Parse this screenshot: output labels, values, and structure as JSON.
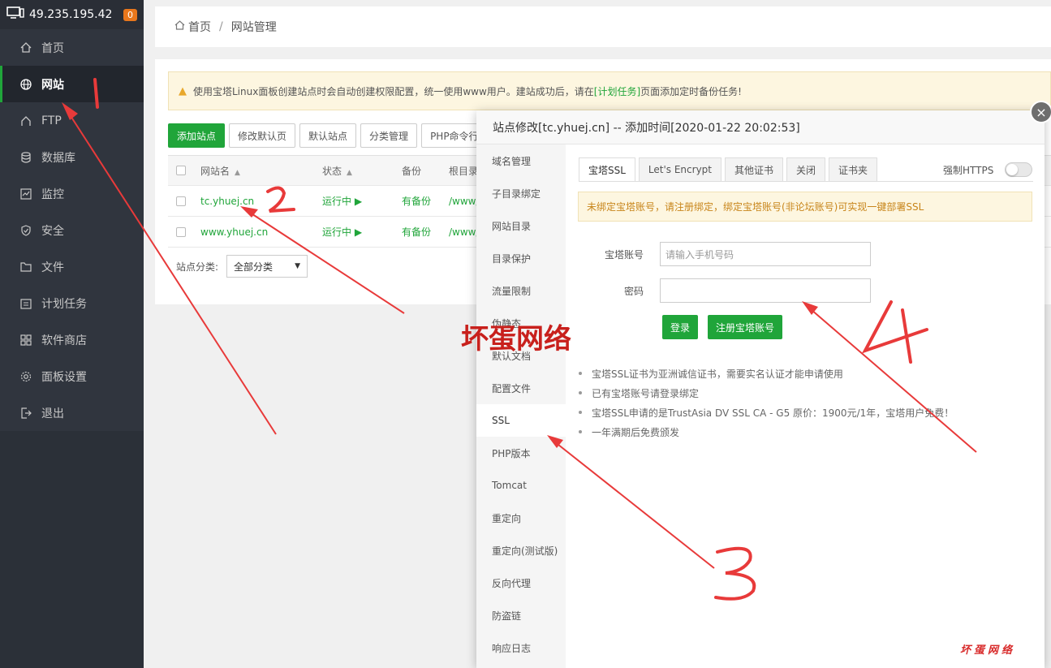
{
  "sidebar": {
    "ip": "49.235.195.42",
    "badge": "0",
    "items": [
      {
        "label": "首页",
        "icon": "home-icon"
      },
      {
        "label": "网站",
        "icon": "globe-icon"
      },
      {
        "label": "FTP",
        "icon": "ftp-icon"
      },
      {
        "label": "数据库",
        "icon": "database-icon"
      },
      {
        "label": "监控",
        "icon": "monitor-icon"
      },
      {
        "label": "安全",
        "icon": "shield-icon"
      },
      {
        "label": "文件",
        "icon": "folder-icon"
      },
      {
        "label": "计划任务",
        "icon": "calendar-icon"
      },
      {
        "label": "软件商店",
        "icon": "grid-icon"
      },
      {
        "label": "面板设置",
        "icon": "gear-icon"
      },
      {
        "label": "退出",
        "icon": "exit-icon"
      }
    ],
    "plus": "+"
  },
  "breadcrumb": {
    "home": "首页",
    "sep": "/",
    "current": "网站管理"
  },
  "warning": {
    "prefix": "使用宝塔Linux面板创建站点时会自动创建权限配置，统一使用www用户。建站成功后，请在",
    "link": "[计划任务]",
    "suffix": "页面添加定时备份任务!"
  },
  "toolbar": [
    "添加站点",
    "修改默认页",
    "默认站点",
    "分类管理",
    "PHP命令行"
  ],
  "table": {
    "headers": {
      "name": "网站名",
      "status": "状态",
      "backup": "备份",
      "root": "根目录"
    },
    "rows": [
      {
        "name": "tc.yhuej.cn",
        "status": "运行中 ▶",
        "backup": "有备份",
        "root": "/www/"
      },
      {
        "name": "www.yhuej.cn",
        "status": "运行中 ▶",
        "backup": "有备份",
        "root": "/www/"
      }
    ]
  },
  "category": {
    "label": "站点分类:",
    "value": "全部分类",
    "arrow": "▼"
  },
  "modal": {
    "title": "站点修改[tc.yhuej.cn] -- 添加时间[2020-01-22 20:02:53]",
    "close": "×",
    "nav": [
      "域名管理",
      "子目录绑定",
      "网站目录",
      "目录保护",
      "流量限制",
      "伪静态",
      "默认文档",
      "配置文件",
      "SSL",
      "PHP版本",
      "Tomcat",
      "重定向",
      "重定向(测试版)",
      "反向代理",
      "防盗链",
      "响应日志"
    ],
    "tabs": [
      "宝塔SSL",
      "Let's Encrypt",
      "其他证书",
      "关闭",
      "证书夹"
    ],
    "force_https": "强制HTTPS",
    "ssl_warning": "未绑定宝塔账号，请注册绑定，绑定宝塔账号(非论坛账号)可实现一键部署SSL",
    "account_label": "宝塔账号",
    "account_placeholder": "请输入手机号码",
    "password_label": "密码",
    "password_value": "",
    "login_button": "登录",
    "register_button": "注册宝塔账号",
    "notes": [
      "宝塔SSL证书为亚洲诚信证书，需要实名认证才能申请使用",
      "已有宝塔账号请登录绑定",
      "宝塔SSL申请的是TrustAsia DV SSL CA - G5 原价：1900元/1年，宝塔用户免费！",
      "一年满期后免费颁发"
    ]
  },
  "annotations": {
    "watermark": "坏蛋网络",
    "watermark_small": "坏蛋网络",
    "marks": [
      "1",
      "2",
      "3",
      "4"
    ]
  },
  "colors": {
    "sidebar_bg": "#30353e",
    "accent_green": "#20a53a",
    "annotation_red": "#e83a3a"
  }
}
